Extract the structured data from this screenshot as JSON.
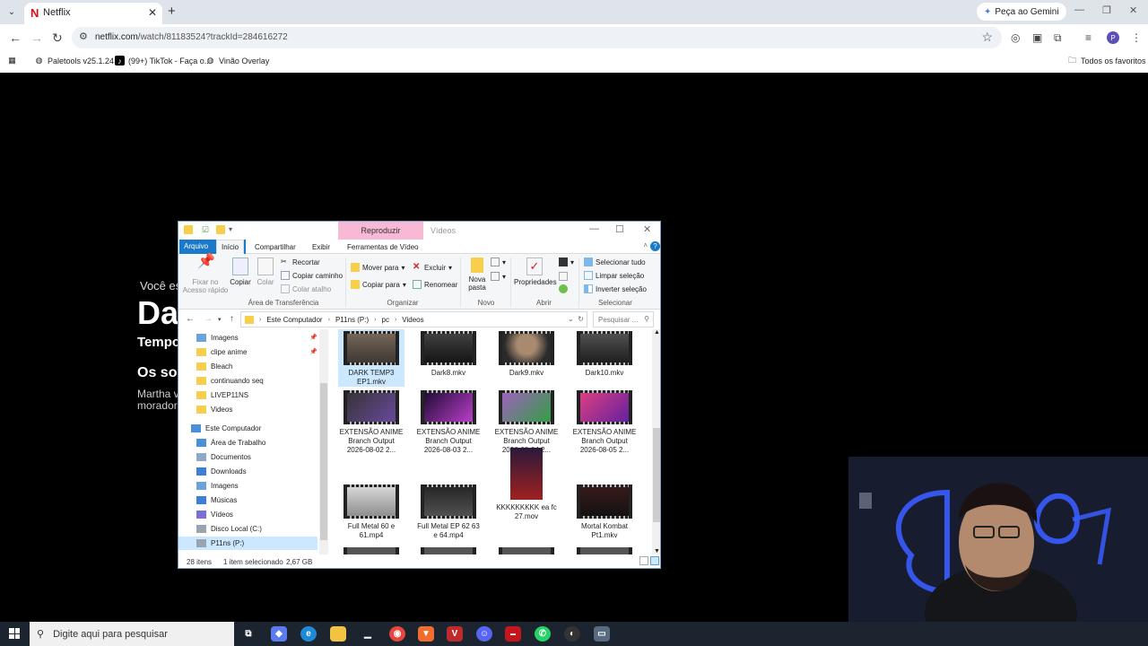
{
  "browser": {
    "tab": {
      "title": "Netflix"
    },
    "gemini_button": "Peça ao Gemini",
    "url_host": "netflix.com",
    "url_path": "/watch/81183524?trackId=284616272",
    "profile_initial": "P",
    "bookmarks": [
      "Paletools v25.1.24",
      "(99+) TikTok - Faça o...",
      "Vinão Overlay"
    ],
    "all_bookmarks": "Todos os favoritos"
  },
  "netflix": {
    "you_are_watching": "Você es",
    "title": "Da",
    "season": "Tempo",
    "episode_title": "Os sob",
    "description": "Martha v morador"
  },
  "explorer": {
    "context_tab": "Reproduzir",
    "window_title": "Vídeos",
    "ribbon_tabs": [
      "Arquivo",
      "Início",
      "Compartilhar",
      "Exibir",
      "Ferramentas de Vídeo"
    ],
    "ribbon": {
      "pin_quick": "Fixar no Acesso rápido",
      "copy": "Copiar",
      "paste": "Colar",
      "cut": "Recortar",
      "copy_path": "Copiar caminho",
      "paste_shortcut": "Colar atalho",
      "group_clipboard": "Área de Transferência",
      "move_to": "Mover para",
      "copy_to": "Copiar para",
      "delete": "Excluir",
      "rename": "Renomear",
      "group_organize": "Organizar",
      "new_folder": "Nova pasta",
      "group_new": "Novo",
      "properties": "Propriedades",
      "group_open": "Abrir",
      "select_all": "Selecionar tudo",
      "clear_selection": "Limpar seleção",
      "invert_selection": "Inverter seleção",
      "group_select": "Selecionar"
    },
    "breadcrumb": [
      "Este Computador",
      "P11ns (P:)",
      "pc",
      "Videos"
    ],
    "search_placeholder": "Pesquisar ...",
    "nav_items": [
      {
        "label": "Imagens",
        "pinned": true
      },
      {
        "label": "clipe anime",
        "pinned": true
      },
      {
        "label": "Bleach"
      },
      {
        "label": "continuando seq"
      },
      {
        "label": "LIVEP11NS"
      },
      {
        "label": "Videos"
      },
      {
        "label": "Este Computador"
      },
      {
        "label": "Área de Trabalho"
      },
      {
        "label": "Documentos"
      },
      {
        "label": "Downloads"
      },
      {
        "label": "Imagens"
      },
      {
        "label": "Músicas"
      },
      {
        "label": "Vídeos"
      },
      {
        "label": "Disco Local (C:)"
      },
      {
        "label": "P11ns (P:)"
      }
    ],
    "files": [
      {
        "name": "DARK TEMP3 EP1.mkv"
      },
      {
        "name": "Dark8.mkv"
      },
      {
        "name": "Dark9.mkv"
      },
      {
        "name": "Dark10.mkv"
      },
      {
        "name": "EXTENSÃO ANIME Branch Output 2026-08-02 2..."
      },
      {
        "name": "EXTENSÃO ANIME Branch Output 2026-08-03 2..."
      },
      {
        "name": "EXTENSÃO ANIME Branch Output 2026-08-04 2..."
      },
      {
        "name": "EXTENSÃO ANIME Branch Output 2026-08-05 2..."
      },
      {
        "name": "Full Metal 60 e 61.mp4"
      },
      {
        "name": "Full Metal EP 62 63 e 64.mp4"
      },
      {
        "name": "KKKKKKKKK ea fc 27.mov"
      },
      {
        "name": "Mortal Kombat Pt1.mkv"
      }
    ],
    "status": {
      "count": "28 itens",
      "selected": "1 item selecionado",
      "size": "2,67 GB"
    }
  },
  "taskbar": {
    "search_placeholder": "Digite aqui para pesquisar"
  }
}
